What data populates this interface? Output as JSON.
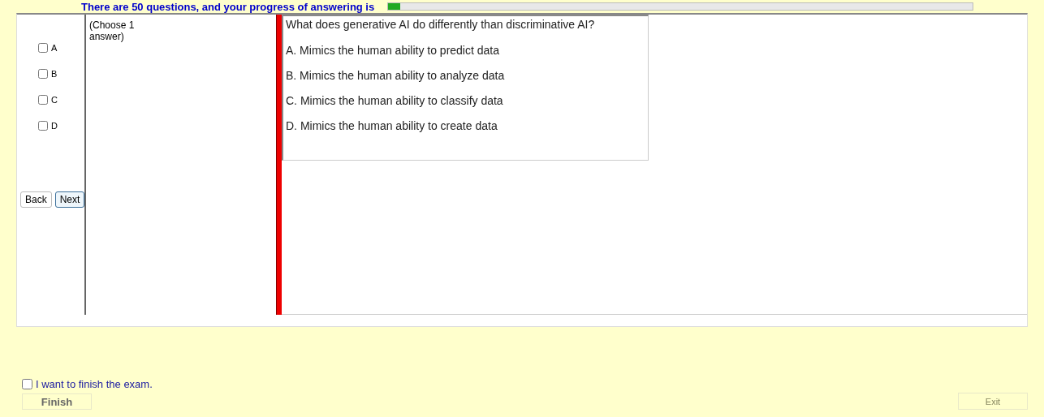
{
  "header": {
    "text": "There are 50 questions, and your progress of answering is",
    "progress": {
      "level": 0.02
    }
  },
  "answer_options": [
    {
      "label": "A",
      "checked": false
    },
    {
      "label": "B",
      "checked": false
    },
    {
      "label": "C",
      "checked": false
    },
    {
      "label": "D",
      "checked": false
    }
  ],
  "nav_buttons": [
    {
      "label": "Back",
      "selected": false
    },
    {
      "label": "Next",
      "selected": true
    }
  ],
  "instruction": "(Choose 1 answer)",
  "question": {
    "text": "What does generative AI do differently than discriminative AI?",
    "choices": [
      "A.  Mimics the human ability to predict data",
      "B.  Mimics the human ability to analyze data",
      "C.  Mimics the human ability to classify data",
      "D.  Mimics the human ability to create data"
    ]
  },
  "finish": {
    "label": "I want to finish the exam.",
    "checked": false,
    "button": "Finish"
  },
  "exit_button": "Exit"
}
